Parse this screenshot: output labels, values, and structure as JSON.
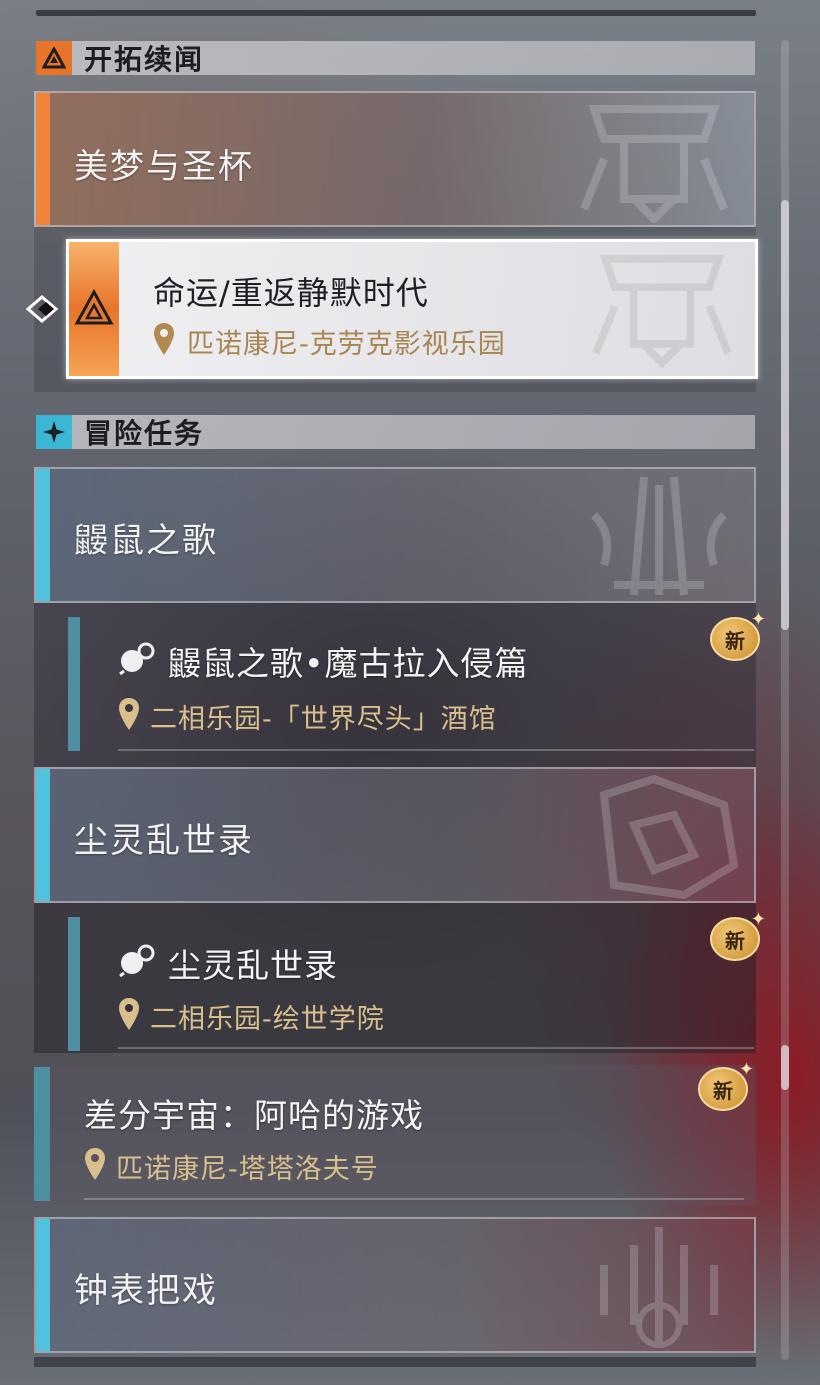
{
  "sections": {
    "trailblaze": {
      "title": "开拓续闻"
    },
    "adventure": {
      "title": "冒险任务"
    }
  },
  "trailblaze_group": {
    "title": "美梦与圣杯",
    "quest": {
      "name": "命运/重返静默时代",
      "location": "匹诺康尼-克劳克影视乐园"
    }
  },
  "adventure_groups": [
    {
      "title": "鼹鼠之歌",
      "quest": {
        "name": "鼹鼠之歌•魔古拉入侵篇",
        "location": "二相乐园-「世界尽头」酒馆",
        "badge": "新"
      }
    },
    {
      "title": "尘灵乱世录",
      "quest": {
        "name": "尘灵乱世录",
        "location": "二相乐园-绘世学院",
        "badge": "新"
      }
    },
    {
      "standalone": true,
      "quest": {
        "name": "差分宇宙：阿哈的游戏",
        "location": "匹诺康尼-塔塔洛夫号",
        "badge": "新"
      }
    },
    {
      "title": "钟表把戏"
    }
  ],
  "colors": {
    "trailblaze_accent": "#f0843a",
    "adventure_accent": "#4fc2de",
    "sub_bar": "#4f8fa2",
    "location_text": "#d9bf8c",
    "badge_gold": "#e0a94a"
  },
  "icons": {
    "trailblaze_section": "trailblaze-triangle-icon",
    "adventure_section": "sparkle-icon",
    "location": "map-pin-icon",
    "quest_type": "adventure-quest-icon",
    "selected_marker": "chevron-selector-icon"
  }
}
